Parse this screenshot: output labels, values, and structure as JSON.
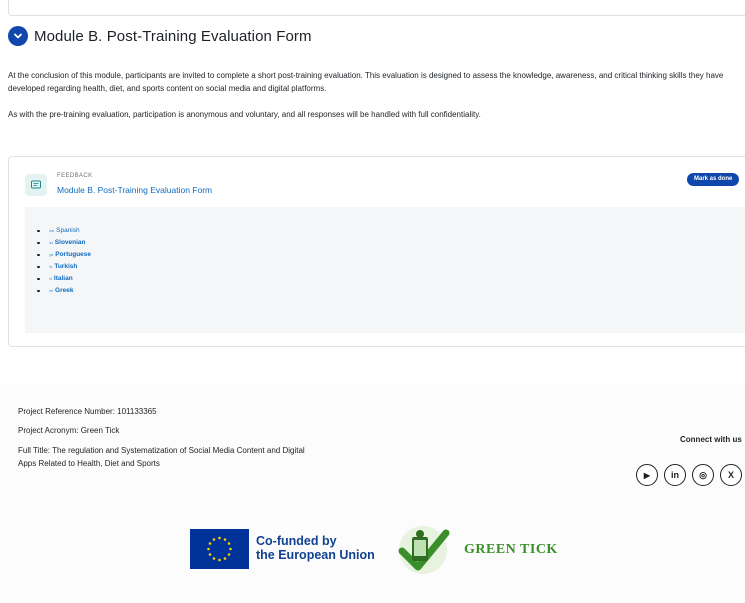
{
  "section": {
    "title": "Module B. Post-Training Evaluation Form",
    "description_1": "At the conclusion of this module, participants are invited to complete a short post-training evaluation. This evaluation is designed to assess the knowledge, awareness, and critical thinking skills they have developed regarding health, diet, and sports content on social media and digital platforms.",
    "description_2": "As with the pre-training evaluation, participation is anonymous and voluntary, and all responses will be handled with full confidentiality."
  },
  "activity": {
    "icon": "feedback-icon",
    "type_label": "FEEDBACK",
    "name": "Module B. Post-Training Evaluation Form",
    "mark_done_label": "Mark as done",
    "languages": [
      {
        "code": "es",
        "name": "Spanish",
        "bold": false
      },
      {
        "code": "sl",
        "name": "Slovenian",
        "bold": true
      },
      {
        "code": "pt",
        "name": "Portuguese",
        "bold": true
      },
      {
        "code": "tr",
        "name": "Turkish",
        "bold": true
      },
      {
        "code": "it",
        "name": "Italian",
        "bold": true
      },
      {
        "code": "el",
        "name": "Greek",
        "bold": true
      }
    ]
  },
  "footer": {
    "reference": "Project Reference Number: 101133365",
    "acronym": "Project Acronym: Green Tick",
    "full_title_1": "Full Title: The regulation and Systematization of Social Media Content and Digital",
    "full_title_2": "Apps Related to Health, Diet and Sports",
    "connect_label": "Connect with us",
    "social": [
      {
        "icon": "youtube-icon",
        "glyph": "▶"
      },
      {
        "icon": "linkedin-icon",
        "glyph": "in"
      },
      {
        "icon": "instagram-icon",
        "glyph": "◎"
      },
      {
        "icon": "x-icon",
        "glyph": "X"
      }
    ],
    "eu_line_1": "Co-funded by",
    "eu_line_2": "the European Union",
    "partner_name": "GREEN TICK"
  },
  "colors": {
    "accent": "#0f47ad",
    "link": "#0f6cbf",
    "eu_blue": "#003399",
    "eu_star": "#ffcc00",
    "green_tick": "#3b8f2a"
  }
}
